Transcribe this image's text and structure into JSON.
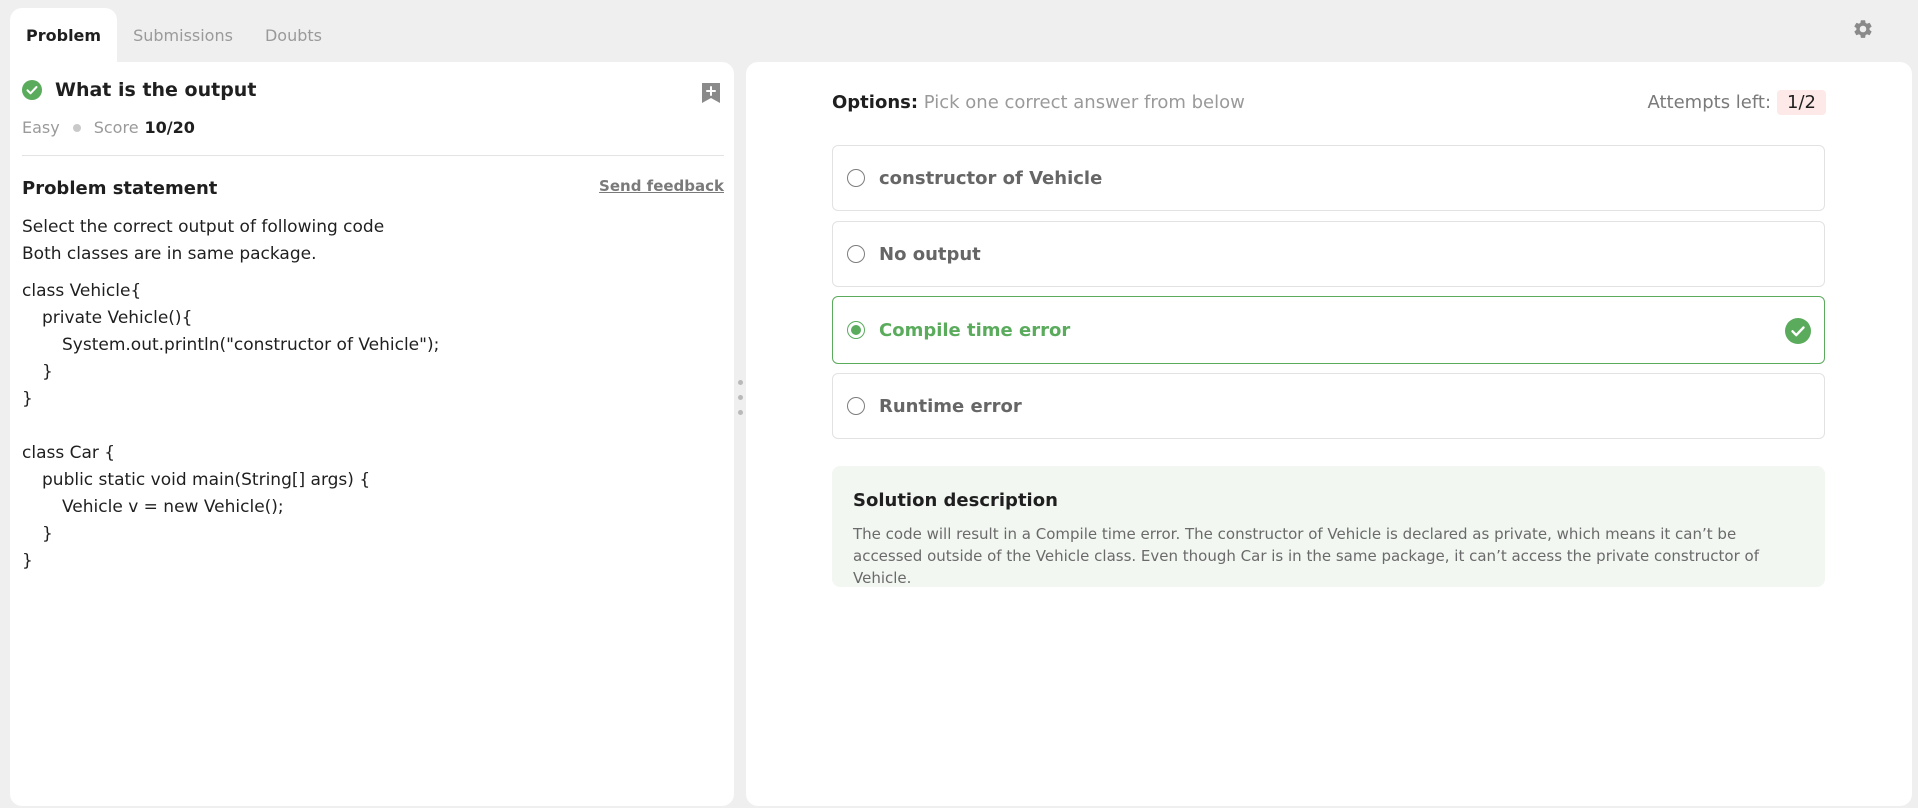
{
  "tabs": [
    {
      "label": "Problem",
      "active": true
    },
    {
      "label": "Submissions",
      "active": false
    },
    {
      "label": "Doubts",
      "active": false
    }
  ],
  "problem": {
    "title": "What is the output",
    "difficulty": "Easy",
    "score_label": "Score",
    "score_value": "10/20",
    "statement_title": "Problem statement",
    "feedback_label": "Send feedback",
    "statement_lines": [
      "Select the correct output of following code",
      "Both classes are in same package."
    ],
    "code_lines": [
      "class Vehicle{",
      "private Vehicle(){",
      "System.out.println(\"constructor of Vehicle\");",
      "}",
      "}",
      "",
      "class Car {",
      "public static void main(String[] args) {",
      "Vehicle v = new Vehicle();",
      "}",
      "}"
    ]
  },
  "options_panel": {
    "label": "Options:",
    "hint": "Pick one correct answer from below",
    "attempts_label": "Attempts left:",
    "attempts_value": "1/2",
    "options": [
      {
        "text": "constructor of Vehicle",
        "selected": false
      },
      {
        "text": "No output",
        "selected": false
      },
      {
        "text": "Compile time error",
        "selected": true,
        "correct": true
      },
      {
        "text": "Runtime error",
        "selected": false
      }
    ]
  },
  "solution": {
    "title": "Solution description",
    "body": "The code will result in a Compile time error. The constructor of Vehicle is declared as private, which means it can’t be accessed outside of the Vehicle class. Even though Car is in the same package, it can’t access the private constructor of Vehicle."
  },
  "colors": {
    "success": "#5bab5d",
    "attempts_badge_bg": "#fde9e7",
    "solution_bg": "#f2f7f2"
  },
  "icons": {
    "settings": "gear-icon",
    "bookmark": "bookmark-plus-icon",
    "solved": "check-circle-icon",
    "correct": "check-circle-icon"
  }
}
